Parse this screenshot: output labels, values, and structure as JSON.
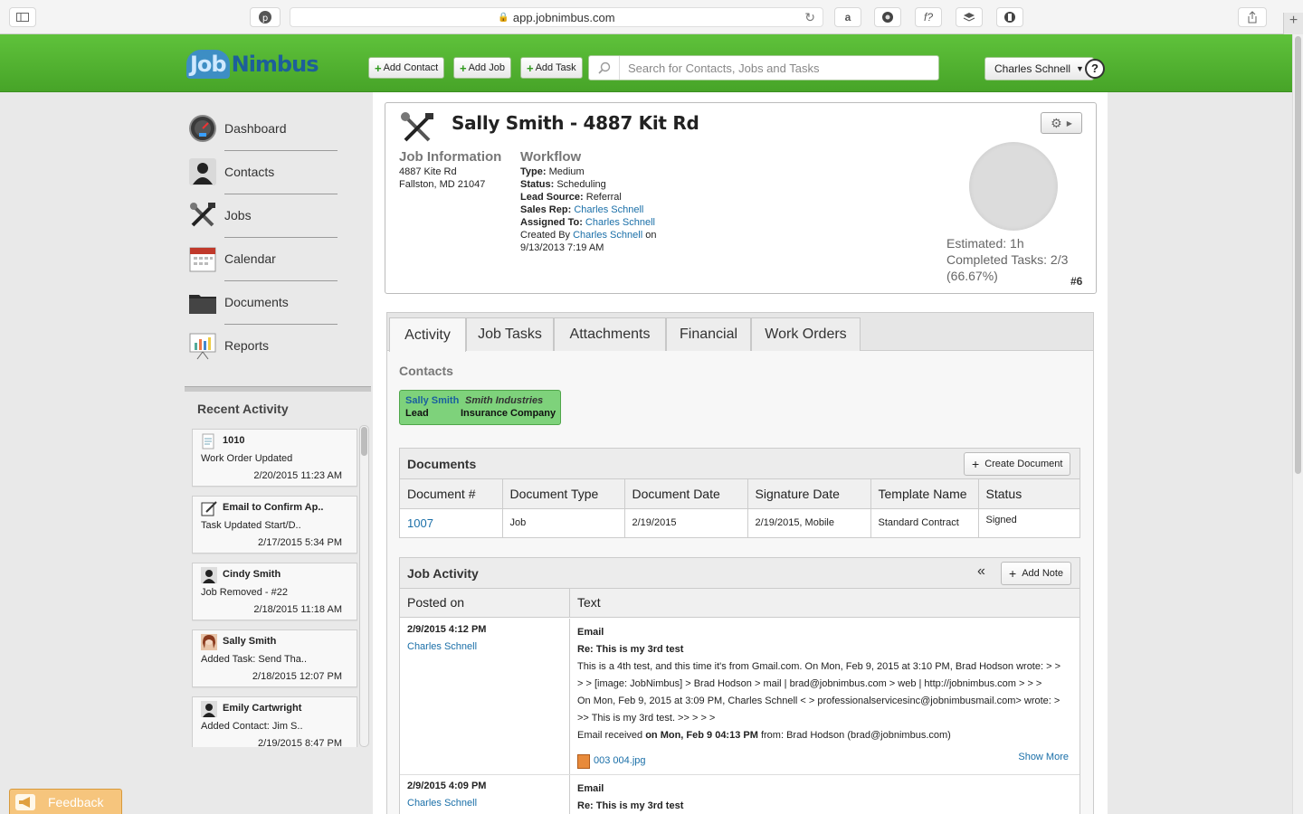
{
  "browser": {
    "url": "app.jobnimbus.com"
  },
  "header": {
    "logo_job": "Job",
    "logo_nimbus": "Nimbus",
    "add_contact": "Add Contact",
    "add_job": "Add Job",
    "add_task": "Add Task",
    "search_placeholder": "Search for Contacts, Jobs and Tasks",
    "user_name": "Charles Schnell",
    "help": "?"
  },
  "sidebar": {
    "items": [
      {
        "label": "Dashboard",
        "icon": "dashboard-gauge-icon"
      },
      {
        "label": "Contacts",
        "icon": "person-icon"
      },
      {
        "label": "Jobs",
        "icon": "tools-icon"
      },
      {
        "label": "Calendar",
        "icon": "calendar-icon"
      },
      {
        "label": "Documents",
        "icon": "folder-icon"
      },
      {
        "label": "Reports",
        "icon": "chart-easel-icon"
      }
    ],
    "recent_title": "Recent Activity",
    "recent": [
      {
        "title": "1010",
        "sub": "Work Order Updated",
        "date": "2/20/2015 11:23 AM",
        "icon": "document-icon"
      },
      {
        "title": "Email to Confirm Ap..",
        "sub": "Task Updated Start/D..",
        "date": "2/17/2015 5:34 PM",
        "icon": "task-edit-icon"
      },
      {
        "title": "Cindy Smith",
        "sub": "Job Removed - #22",
        "date": "2/18/2015 11:18 AM",
        "icon": "person-icon"
      },
      {
        "title": "Sally Smith",
        "sub": "Added Task: Send Tha..",
        "date": "2/18/2015 12:07 PM",
        "icon": "photo-avatar-icon"
      },
      {
        "title": "Emily Cartwright",
        "sub": "Added Contact: Jim S..",
        "date": "2/19/2015 8:47 PM",
        "icon": "person-icon"
      }
    ],
    "feedback": "Feedback"
  },
  "job": {
    "title": "Sally Smith - 4887 Kit Rd",
    "info_heading": "Job Information",
    "address_line1": "4887 Kite Rd",
    "address_line2": "Fallston, MD 21047",
    "workflow_heading": "Workflow",
    "type_label": "Type:",
    "type_value": "Medium",
    "status_label": "Status:",
    "status_value": "Scheduling",
    "lead_label": "Lead Source:",
    "lead_value": "Referral",
    "salesrep_label": "Sales Rep:",
    "salesrep_value": "Charles Schnell",
    "assigned_label": "Assigned To:",
    "assigned_value": "Charles Schnell",
    "created_prefix": "Created By",
    "created_by": "Charles Schnell",
    "created_suffix": "on",
    "created_date": "9/13/2013 7:19 AM",
    "estimated": "Estimated: 1h",
    "completed": "Completed Tasks: 2/3",
    "percent": "(66.67%)",
    "number": "#6"
  },
  "tabs": [
    "Activity",
    "Job Tasks",
    "Attachments",
    "Financial",
    "Work Orders"
  ],
  "contacts": {
    "heading": "Contacts",
    "card": {
      "name1": "Sally Smith",
      "type1": "Lead",
      "name2": "Smith Industries",
      "type2": "Insurance Company"
    }
  },
  "documents": {
    "heading": "Documents",
    "create_btn": "Create Document",
    "columns": [
      "Document #",
      "Document Type",
      "Document Date",
      "Signature Date",
      "Template Name",
      "Status"
    ],
    "rows": [
      {
        "num": "1007",
        "type": "Job",
        "date": "2/19/2015",
        "sig": "2/19/2015, Mobile",
        "template": "Standard Contract",
        "status": "Signed"
      }
    ]
  },
  "activity": {
    "heading": "Job Activity",
    "add_note": "Add Note",
    "col_posted": "Posted on",
    "col_text": "Text",
    "rows": [
      {
        "when": "2/9/2015 4:12 PM",
        "who": "Charles Schnell",
        "kind": "Email",
        "subject": "Re: This is my 3rd test",
        "body1": "This is a 4th test, and this time it's from Gmail.com. On Mon, Feb 9, 2015 at 3:10 PM, Brad Hodson wrote: > >",
        "body2": "> > [image: JobNimbus] > Brad Hodson > mail | brad@jobnimbus.com > web | http://jobnimbus.com > > >",
        "body3": "On Mon, Feb 9, 2015 at 3:09 PM, Charles Schnell < > professionalservicesinc@jobnimbusmail.com> wrote: >",
        "body4": ">> This is my 3rd test. >> > > >",
        "received_prefix": "Email received",
        "received_on": "on Mon, Feb 9 04:13 PM",
        "received_from": "from: Brad Hodson (brad@jobnimbus.com)",
        "attachment": "003 004.jpg",
        "show_more": "Show More"
      },
      {
        "when": "2/9/2015 4:09 PM",
        "who": "Charles Schnell",
        "kind": "Email",
        "subject": "Re: This is my 3rd test"
      }
    ]
  }
}
